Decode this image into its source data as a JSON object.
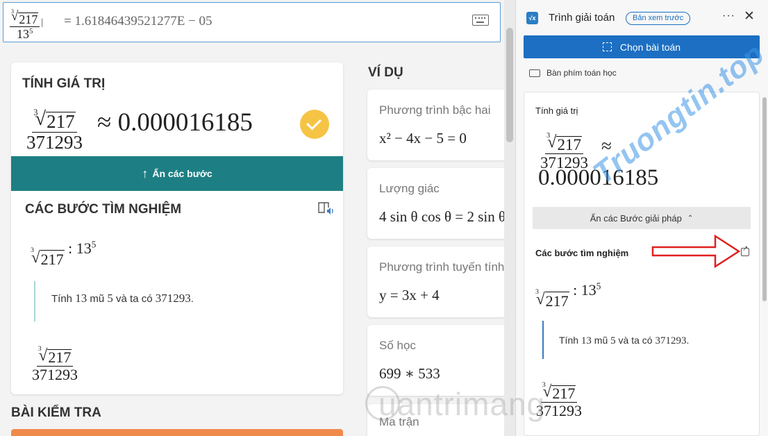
{
  "input": {
    "radicand": "217",
    "root_index": "3",
    "base": "13",
    "exponent": "5",
    "result_text": "= 1.61846439521277E − 05"
  },
  "eval_card": {
    "heading": "TÍNH GIÁ TRỊ",
    "index": "3",
    "radicand": "217",
    "denominator": "371293",
    "approx": "≈",
    "result": "0.000016185",
    "hide_steps_label": "Ẩn các bước",
    "steps_heading": "CÁC BƯỚC TÌM NGHIỆM",
    "step1": {
      "index": "3",
      "radicand": "217",
      "colon": ":",
      "base": "13",
      "exponent": "5"
    },
    "step1_explain": {
      "pre": "Tính",
      "base": "13",
      "mid": "mũ",
      "exp": "5",
      "post": "và ta có",
      "value": "371293",
      "end": "."
    },
    "step2": {
      "index": "3",
      "radicand": "217",
      "denominator": "371293"
    }
  },
  "quiz_heading": "BÀI KIỂM TRA",
  "examples": {
    "heading": "VÍ DỤ",
    "items": [
      {
        "title": "Phương trình bậc hai",
        "expr": "x² − 4x − 5 = 0"
      },
      {
        "title": "Lượng giác",
        "expr": "4 sin θ cos θ = 2 sin θ"
      },
      {
        "title": "Phương trình tuyến tính",
        "expr": "y = 3x + 4"
      },
      {
        "title": "Số học",
        "expr": "699 ∗ 533"
      },
      {
        "title": "Ma trận",
        "expr": ""
      }
    ]
  },
  "panel": {
    "app_title": "Trình giải toán",
    "app_icon_text": "√x",
    "preview_badge": "Bản xem trước",
    "more": "···",
    "close": "✕",
    "choose_problem_label": "Chọn bài toán",
    "math_keyboard_label": "Bàn phím toán học",
    "eval_label": "Tính giá trị",
    "index": "3",
    "radicand": "217",
    "denominator": "371293",
    "approx": "≈",
    "result": "0.000016185",
    "hide_solution_label": "Ẩn các Bước giải pháp",
    "chevron_up": "⌃",
    "steps_label": "Các bước tìm nghiệm",
    "step1": {
      "index": "3",
      "radicand": "217",
      "colon": ":",
      "base": "13",
      "exponent": "5"
    },
    "explain": {
      "pre": "Tính",
      "base": "13",
      "mid": "mũ",
      "exp": "5",
      "post": "và ta có",
      "value": "371293",
      "end": "."
    },
    "step2": {
      "index": "3",
      "radicand": "217",
      "denominator": "371293"
    }
  },
  "watermarks": {
    "top": "Truongtin.top",
    "bottom": "uantrimang"
  },
  "colors": {
    "teal": "#1d7f84",
    "accent_blue": "#1c6fc2",
    "check_yellow": "#f5c444",
    "arrow_red": "#e02020",
    "quiz_orange": "#f08a4b"
  }
}
